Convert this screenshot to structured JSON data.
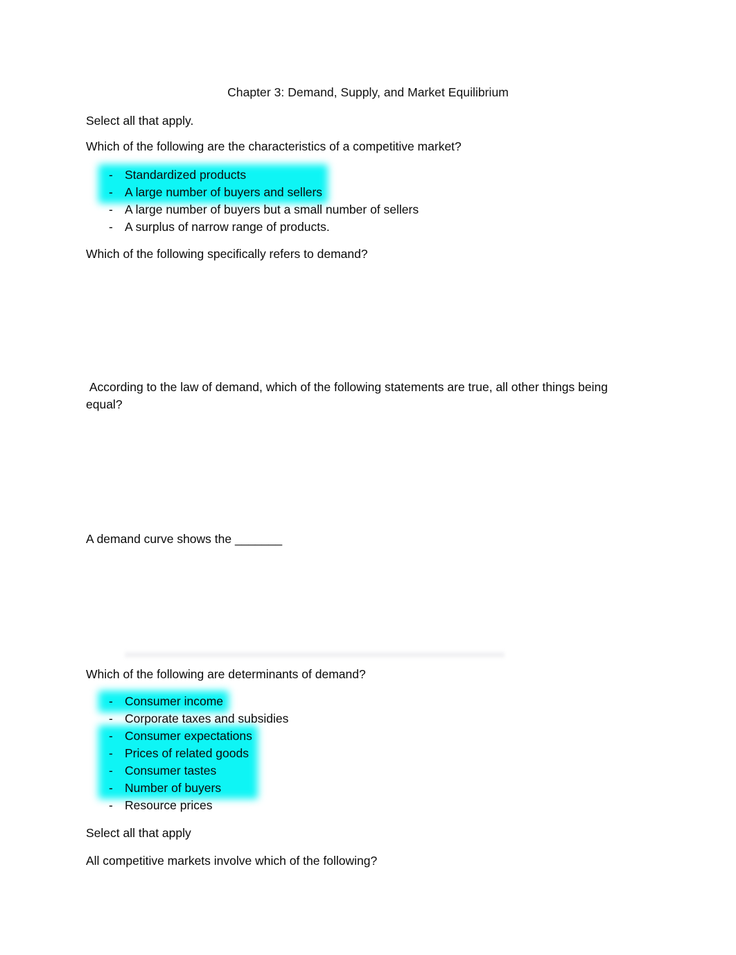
{
  "document": {
    "title": "Chapter 3: Demand, Supply, and Market Equilibrium",
    "highlight_color": "#0EF5F5",
    "text_color": "#0A0A0A",
    "background_color": "#FFFFFF"
  },
  "sections": {
    "select_all_1": "Select all that apply.",
    "question_1": "Which of the following are the characteristics of a competitive market?",
    "question_2": "Which of the following specifically refers to demand?",
    "question_3": " According to the law of demand, which of the following statements are true, all other things being equal?",
    "question_4": "A demand curve shows the _______",
    "question_5": "Which of the following are determinants of demand?",
    "select_all_2": "Select all that apply",
    "question_6": "All competitive markets involve which of the following?"
  },
  "list_competitive_market": {
    "bullet_marker": "-",
    "items": [
      {
        "text": "Standardized products",
        "highlighted": true
      },
      {
        "text": "A large number of buyers and sellers",
        "highlighted": true
      },
      {
        "text": "A large number of buyers but a small number of sellers",
        "highlighted": false
      },
      {
        "text": "A surplus of narrow range of products.",
        "highlighted": false
      }
    ]
  },
  "list_determinants": {
    "bullet_marker": "-",
    "items": [
      {
        "text": "Consumer income",
        "highlighted": true
      },
      {
        "text": "Corporate taxes and subsidies",
        "highlighted": false
      },
      {
        "text": "Consumer expectations",
        "highlighted": true
      },
      {
        "text": "Prices of related goods",
        "highlighted": true
      },
      {
        "text": "Consumer tastes",
        "highlighted": true
      },
      {
        "text": "Number of buyers",
        "highlighted": true
      },
      {
        "text": "Resource prices",
        "highlighted": false
      }
    ]
  }
}
